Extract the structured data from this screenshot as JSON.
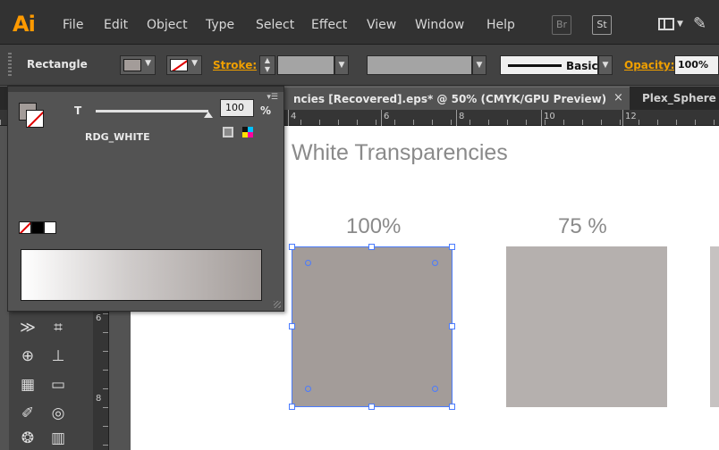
{
  "app": {
    "logo": "Ai",
    "menu": [
      "File",
      "Edit",
      "Object",
      "Type",
      "Select",
      "Effect",
      "View",
      "Window",
      "Help"
    ],
    "bridge_label": "Br",
    "stock_label": "St"
  },
  "control_bar": {
    "tool_name": "Rectangle",
    "stroke_label": "Stroke:",
    "stroke_profile": "Basic",
    "opacity_label": "Opacity:",
    "opacity_value": "100%"
  },
  "tabs": {
    "active_doc": "ncies  [Recovered].eps* @ 50% (CMYK/GPU Preview)",
    "close": "×",
    "second_doc": "Plex_Sphere"
  },
  "rulers": {
    "horizontal": [
      "4",
      "6",
      "8",
      "10",
      "12"
    ],
    "vertical": [
      "6",
      "8"
    ]
  },
  "gradient_panel": {
    "tint_label": "T",
    "tint_value": "100",
    "tint_unit": "%",
    "tint_level": 1.0,
    "swatch_name": "RDG_WHITE",
    "menu_icon": "panel-menu-icon"
  },
  "artboard": {
    "title": "White Transparencies",
    "squares": [
      {
        "label": "100%",
        "color": "#a39c99"
      },
      {
        "label": "75 %",
        "color": "#b5b0ae"
      }
    ]
  },
  "colors": {
    "accent": "#ff9a00",
    "selection": "#4a7bff",
    "fill": "#a39c99",
    "stroke_none": "#e00000"
  }
}
